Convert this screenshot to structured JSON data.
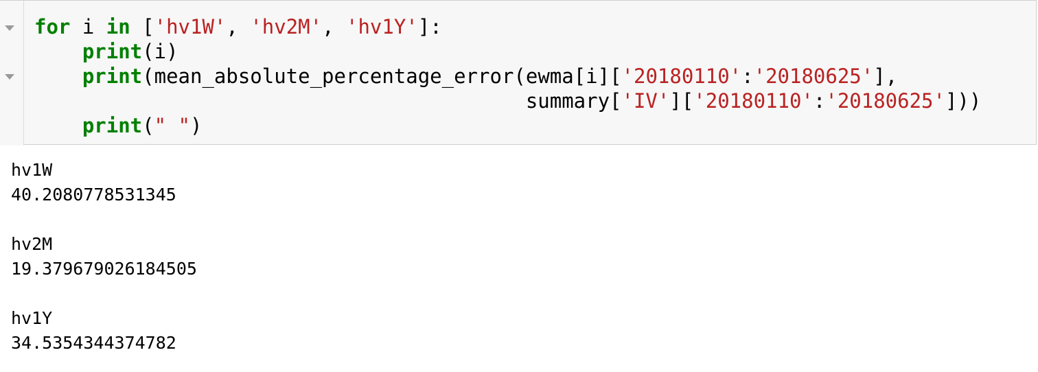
{
  "code_cell": {
    "lines": [
      [
        {
          "t": "for",
          "c": "kw"
        },
        {
          "t": " i ",
          "c": ""
        },
        {
          "t": "in",
          "c": "kw"
        },
        {
          "t": " [",
          "c": ""
        },
        {
          "t": "'hv1W'",
          "c": "str"
        },
        {
          "t": ", ",
          "c": ""
        },
        {
          "t": "'hv2M'",
          "c": "str"
        },
        {
          "t": ", ",
          "c": ""
        },
        {
          "t": "'hv1Y'",
          "c": "str"
        },
        {
          "t": "]:",
          "c": ""
        }
      ],
      [
        {
          "t": "    ",
          "c": ""
        },
        {
          "t": "print",
          "c": "kw"
        },
        {
          "t": "(i)",
          "c": ""
        }
      ],
      [
        {
          "t": "    ",
          "c": ""
        },
        {
          "t": "print",
          "c": "kw"
        },
        {
          "t": "(mean_absolute_percentage_error(ewma[i][",
          "c": ""
        },
        {
          "t": "'20180110'",
          "c": "str"
        },
        {
          "t": ":",
          "c": ""
        },
        {
          "t": "'20180625'",
          "c": "str"
        },
        {
          "t": "],",
          "c": ""
        }
      ],
      [
        {
          "t": "                                         summary[",
          "c": ""
        },
        {
          "t": "'IV'",
          "c": "str"
        },
        {
          "t": "][",
          "c": ""
        },
        {
          "t": "'20180110'",
          "c": "str"
        },
        {
          "t": ":",
          "c": ""
        },
        {
          "t": "'20180625'",
          "c": "str"
        },
        {
          "t": "]))",
          "c": ""
        }
      ],
      [
        {
          "t": "    ",
          "c": ""
        },
        {
          "t": "print",
          "c": "kw"
        },
        {
          "t": "(",
          "c": ""
        },
        {
          "t": "\" \"",
          "c": "str"
        },
        {
          "t": ")",
          "c": ""
        }
      ]
    ]
  },
  "output": {
    "lines": [
      "hv1W",
      "40.2080778531345",
      " ",
      "hv2M",
      "19.379679026184505",
      " ",
      "hv1Y",
      "34.5354344374782"
    ]
  },
  "colors": {
    "keyword": "#008000",
    "string": "#ba2121",
    "cell_background": "#f7f7f7",
    "cell_border": "#cfcfcf"
  }
}
